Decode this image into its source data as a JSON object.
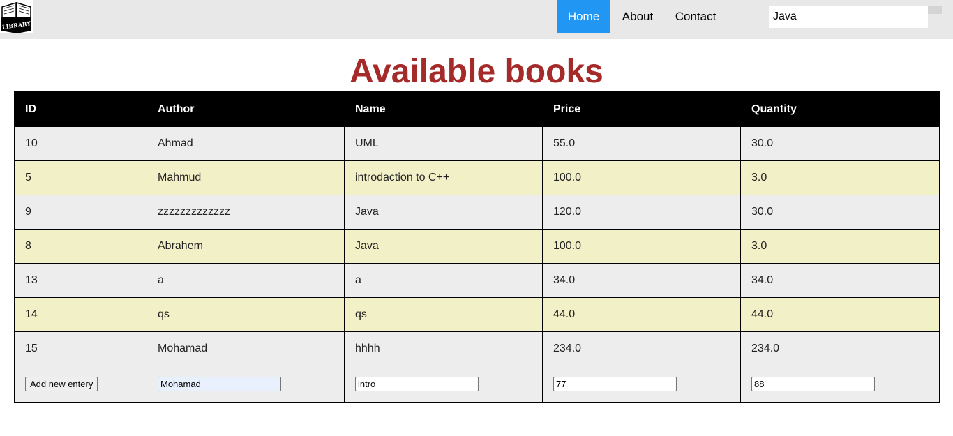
{
  "header": {
    "logo_text": "LIBRARY",
    "nav": [
      {
        "label": "Home",
        "active": true
      },
      {
        "label": "About",
        "active": false
      },
      {
        "label": "Contact",
        "active": false
      }
    ],
    "search": {
      "value": "Java"
    }
  },
  "main": {
    "title": "Available books",
    "columns": [
      "ID",
      "Author",
      "Name",
      "Price",
      "Quantity"
    ],
    "rows": [
      [
        "10",
        "Ahmad",
        "UML",
        "55.0",
        "30.0"
      ],
      [
        "5",
        "Mahmud",
        "introdaction to C++",
        "100.0",
        "3.0"
      ],
      [
        "9",
        "zzzzzzzzzzzzz",
        "Java",
        "120.0",
        "30.0"
      ],
      [
        "8",
        "Abrahem",
        "Java",
        "100.0",
        "3.0"
      ],
      [
        "13",
        "a",
        "a",
        "34.0",
        "34.0"
      ],
      [
        "14",
        "qs",
        "qs",
        "44.0",
        "44.0"
      ],
      [
        "15",
        "Mohamad",
        "hhhh",
        "234.0",
        "234.0"
      ]
    ],
    "new_entry": {
      "button_label": "Add new entery",
      "author": "Mohamad",
      "name": "intro",
      "price": "77",
      "quantity": "88"
    }
  },
  "colors": {
    "nav_active": "#2196f3",
    "title": "#a52a2a",
    "header_row": "#000000",
    "row_odd": "#ededed",
    "row_even": "#f2f0c6",
    "topbar": "#e8e8e8"
  }
}
